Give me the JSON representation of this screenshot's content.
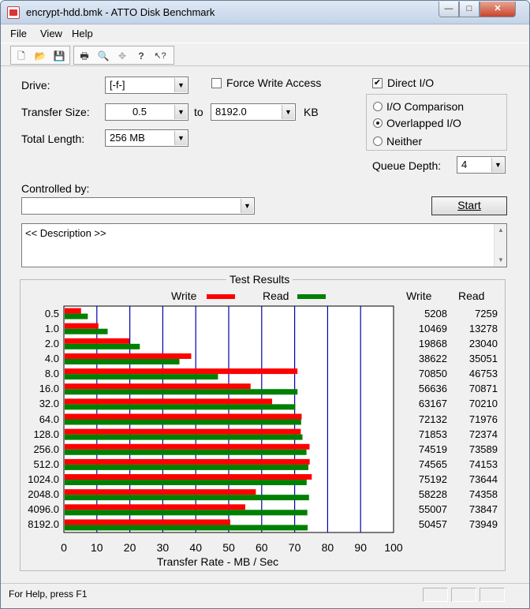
{
  "window": {
    "title": "encrypt-hdd.bmk - ATTO Disk Benchmark",
    "minimize_glyph": "—",
    "maximize_glyph": "□",
    "close_glyph": "✕"
  },
  "menu": {
    "items": [
      {
        "label": "File",
        "accel": "F"
      },
      {
        "label": "View",
        "accel": "V"
      },
      {
        "label": "Help",
        "accel": "H"
      }
    ]
  },
  "toolbar": {
    "buttons": [
      {
        "name": "new-icon",
        "glyph": "🗋"
      },
      {
        "name": "open-folder-icon",
        "glyph": "📂"
      },
      {
        "name": "save-icon",
        "glyph": "💾"
      },
      {
        "name": "print-icon",
        "glyph": "🖶"
      },
      {
        "name": "print-preview-icon",
        "glyph": "🔍"
      },
      {
        "name": "move-icon",
        "glyph": "✥"
      },
      {
        "name": "about-icon",
        "glyph": "?"
      },
      {
        "name": "context-help-icon",
        "glyph": "↖?"
      }
    ]
  },
  "form": {
    "drive_label": "Drive:",
    "drive_value": "[-f-]",
    "force_write_label": "Force Write Access",
    "force_write_checked": false,
    "direct_io_label": "Direct I/O",
    "direct_io_checked": true,
    "transfer_size_label": "Transfer Size:",
    "transfer_from": "0.5",
    "to_label": "to",
    "transfer_to": "8192.0",
    "kb_label": "KB",
    "total_length_label": "Total Length:",
    "total_length_value": "256 MB",
    "io_mode_options": [
      "I/O Comparison",
      "Overlapped I/O",
      "Neither"
    ],
    "io_mode_selected": "Overlapped I/O",
    "queue_depth_label": "Queue Depth:",
    "queue_depth_value": "4",
    "controlled_by_label": "Controlled by:",
    "controlled_by_value": "",
    "start_label": "Start",
    "description_text": "<< Description >>"
  },
  "results": {
    "title": "Test Results",
    "col_write": "Write",
    "col_read": "Read"
  },
  "chart_data": {
    "type": "bar",
    "orientation": "horizontal",
    "title": "Test Results",
    "xlabel": "Transfer Rate - MB / Sec",
    "ylabel": "",
    "xlim": [
      0,
      100
    ],
    "xticks": [
      "0",
      "10",
      "20",
      "30",
      "40",
      "50",
      "60",
      "70",
      "80",
      "90",
      "100"
    ],
    "categories": [
      "0.5",
      "1.0",
      "2.0",
      "4.0",
      "8.0",
      "16.0",
      "32.0",
      "64.0",
      "128.0",
      "256.0",
      "512.0",
      "1024.0",
      "2048.0",
      "4096.0",
      "8192.0"
    ],
    "series": [
      {
        "name": "Write",
        "color": "#ff0000",
        "kbps": [
          5208,
          10469,
          19868,
          38622,
          70850,
          56636,
          63167,
          72132,
          71853,
          74519,
          74565,
          75192,
          58228,
          55007,
          50457
        ],
        "labels": [
          "5208",
          "10469",
          "19868",
          "38622",
          "70850",
          "56636",
          "63167",
          "72132",
          "71853",
          "74519",
          "74565",
          "75192",
          "58228",
          "55007",
          "50457"
        ]
      },
      {
        "name": "Read",
        "color": "#008000",
        "kbps": [
          7259,
          13278,
          23040,
          35051,
          46753,
          70871,
          70210,
          71976,
          72374,
          73589,
          74153,
          73644,
          74358,
          73847,
          73949
        ],
        "labels": [
          "7259",
          "13278",
          "23040",
          "35051",
          "46753",
          "70871",
          "70210",
          "71976",
          "72374",
          "73589",
          "74153",
          "73644",
          "74358",
          "73847",
          "73949"
        ]
      }
    ],
    "grid": true,
    "grid_color": "#0000b0",
    "legend_placement": "top"
  },
  "status": {
    "text": "For Help, press F1"
  }
}
